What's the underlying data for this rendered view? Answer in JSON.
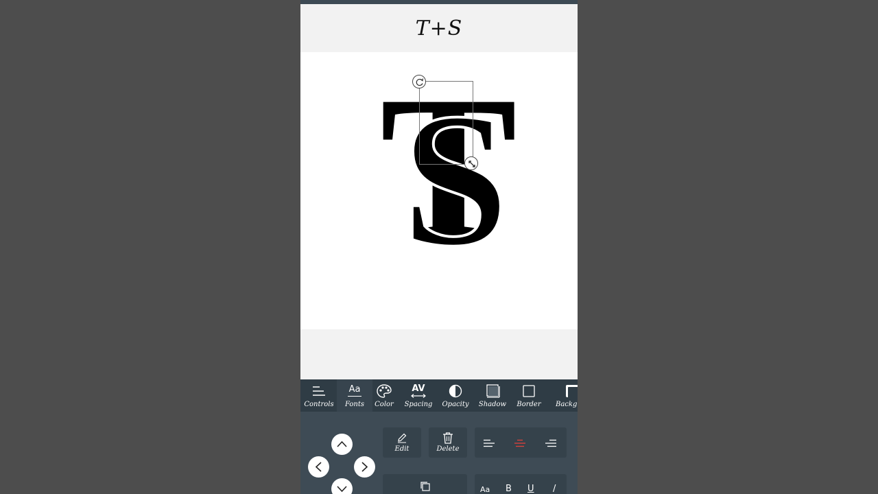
{
  "header": {
    "title": "T+S"
  },
  "canvas": {
    "monogram": {
      "letter_t": "T",
      "letter_s": "S"
    }
  },
  "toolbar": {
    "items": [
      {
        "label": "Controls",
        "icon": "controls-icon"
      },
      {
        "label": "Fonts",
        "icon": "fonts-icon",
        "icon_text": "Aa"
      },
      {
        "label": "Color",
        "icon": "palette-icon"
      },
      {
        "label": "Spacing",
        "icon": "spacing-icon",
        "icon_text": "AV"
      },
      {
        "label": "Opacity",
        "icon": "opacity-icon"
      },
      {
        "label": "Shadow",
        "icon": "shadow-icon"
      },
      {
        "label": "Border",
        "icon": "border-icon"
      },
      {
        "label": "Backgr",
        "icon": "background-icon"
      }
    ],
    "active": "Fonts"
  },
  "panel": {
    "edit_label": "Edit",
    "delete_label": "Delete",
    "align": {
      "selected": "center",
      "accent": "#e0403a"
    },
    "format": {
      "font_case": "Aa",
      "bold": "B",
      "underline": "U",
      "italic": "/"
    }
  },
  "colors": {
    "toolbar_bg": "#2f3c45",
    "panel_bg": "#3e4b55",
    "card_bg": "#35424b",
    "page_bg": "#4d4d4d"
  }
}
